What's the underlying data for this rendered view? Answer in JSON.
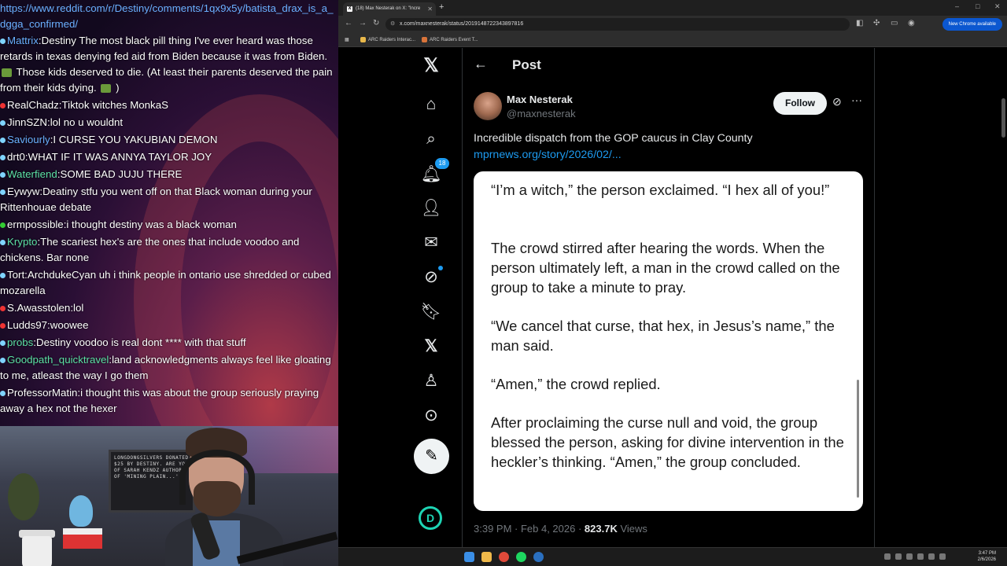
{
  "chat": {
    "url": "https://www.reddit.com/r/Destiny/comments/1qx9x5y/batista_drax_is_a_dgga_confirmed/",
    "messages": [
      {
        "user": "Mattrix",
        "user_color": "#6ab0ff",
        "badge_color": "#7fd4ff",
        "text": "Destiny The most black pill thing I've ever heard was those retards in texas denying fed aid from Biden because it was from Biden. [emote] Those kids deserved to die. (At least their parents deserved the pain from their kids dying. [emote] )"
      },
      {
        "user": "RealChadz",
        "user_color": "#ffffff",
        "badge_color": "#e33",
        "text": "Tiktok witches MonkaS"
      },
      {
        "user": "JinnSZN",
        "user_color": "#ffffff",
        "badge_color": "#7fd4ff",
        "text": "lol no u wouldnt"
      },
      {
        "user": "Saviourly",
        "user_color": "#6ab0ff",
        "badge_color": "#7fd4ff",
        "text": "I CURSE YOU YAKUBIAN DEMON"
      },
      {
        "user": "drt0",
        "user_color": "#ffffff",
        "badge_color": "#7fd4ff",
        "text": "WHAT IF IT WAS ANNYA TAYLOR JOY"
      },
      {
        "user": "Waterfiend",
        "user_color": "#5de0a6",
        "badge_color": "#7fd4ff",
        "text": "SOME BAD JUJU THERE"
      },
      {
        "user": "Eywyw",
        "user_color": "#ffffff",
        "badge_color": "#7fd4ff",
        "text": "Deatiny stfu you went off on that Black woman during your Rittenhouae debate"
      },
      {
        "user": "ermpossible",
        "user_color": "#ffffff",
        "badge_color": "#3c3",
        "text": "i thought destiny was a black woman"
      },
      {
        "user": "Krypto",
        "user_color": "#5de0a6",
        "badge_color": "#7fd4ff",
        "text": "The scariest hex's are the ones that include voodoo and chickens. Bar none"
      },
      {
        "user": "Tort",
        "user_color": "#ffffff",
        "badge_color": "#7fd4ff",
        "text": "ArchdukeCyan uh i think people in ontario use shredded or cubed mozarella"
      },
      {
        "user": "S.Awasstolen",
        "user_color": "#ffffff",
        "badge_color": "#e33",
        "text": "lol"
      },
      {
        "user": "Ludds97",
        "user_color": "#ffffff",
        "badge_color": "#e33",
        "text": "woowee"
      },
      {
        "user": "probs",
        "user_color": "#5de0a6",
        "badge_color": "#7fd4ff",
        "text": "Destiny voodoo is real dont **** with that stuff"
      },
      {
        "user": "Goodpath_quicktravel",
        "user_color": "#5de0a6",
        "badge_color": "#7fd4ff",
        "text": "land acknowledgments always feel like gloating to me, atleast the way I go them"
      },
      {
        "user": "ProfessorMatin",
        "user_color": "#ffffff",
        "badge_color": "#7fd4ff",
        "text": "i thought this was about the group seriously praying away a hex not the hexer"
      }
    ]
  },
  "webcam": {
    "board_text": "LONGDONGSILVERS DONATED $25 BY DESTINY. ARE YOU OF SARAH KENDZ AUTHOR OF 'MINING PLAIN...'"
  },
  "browser": {
    "tab_title": "(18) Max Nesterak on X: \"Incre",
    "url": "x.com/maxnesterak/status/2019148722343897816",
    "update_label": "New Chrome available",
    "bookmarks": [
      "ARC Raiders Interac...",
      "ARC Raiders Event T..."
    ]
  },
  "x": {
    "notif_count": "18",
    "header_title": "Post",
    "author_name": "Max Nesterak",
    "author_handle": "@maxnesterak",
    "follow_label": "Follow",
    "tweet_text": "Incredible dispatch from the GOP caucus in Clay County",
    "tweet_link": "mprnews.org/story/2026/02/...",
    "quote_paragraphs": [
      "“I’m a witch,” the person exclaimed. “I hex all of you!”",
      "The crowd stirred after hearing the words. When the person ultimately left, a man in the crowd called on the group to take a minute to pray.",
      "“We cancel that curse, that hex, in Jesus’s name,” the man said.",
      "“Amen,” the crowd replied.",
      "After proclaiming the curse null and void, the group blessed the person, asking for divine intervention in the heckler’s thinking. “Amen,” the group concluded."
    ],
    "meta_time": "3:39 PM · Feb 4, 2026 · ",
    "meta_views": "823.7K",
    "meta_views_label": " Views"
  },
  "taskbar": {
    "time": "3:47 PM",
    "date": "2/6/2026"
  }
}
